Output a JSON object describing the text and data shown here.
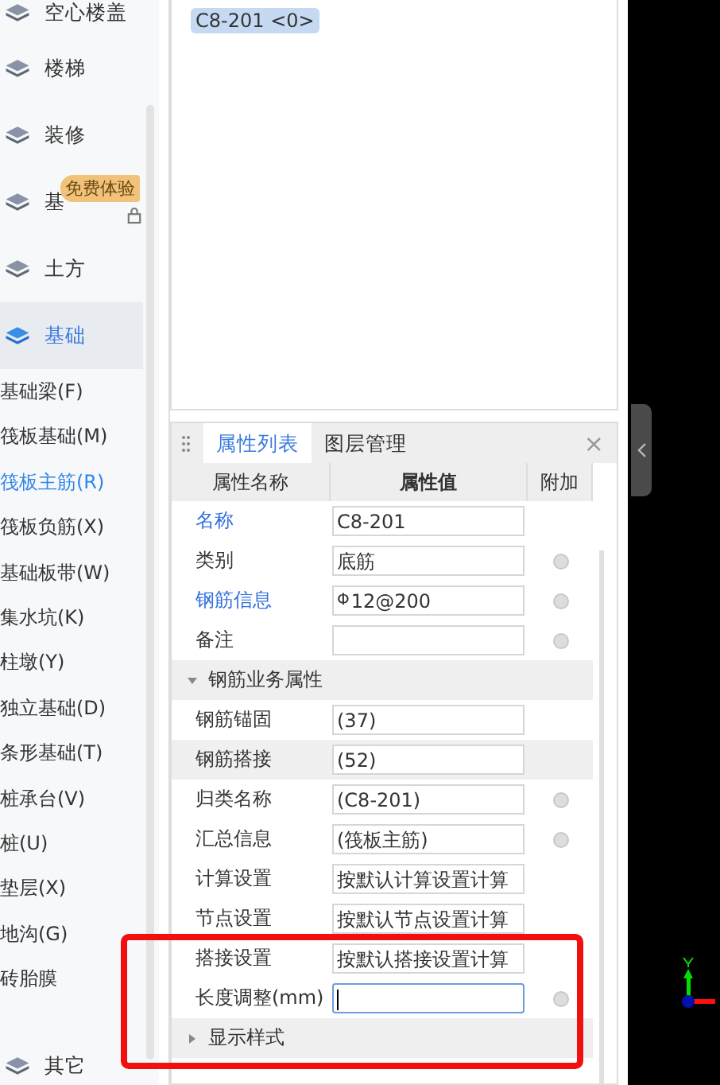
{
  "sidebar": {
    "categories": [
      {
        "label": "空心楼盖",
        "selected": false
      },
      {
        "label": "楼梯",
        "selected": false
      },
      {
        "label": "装修",
        "selected": false
      },
      {
        "label": "基",
        "selected": false,
        "badge": "免费体验",
        "locked": true
      },
      {
        "label": "土方",
        "selected": false
      },
      {
        "label": "基础",
        "selected": true,
        "children": [
          {
            "label": "基础梁(F)",
            "selected": false
          },
          {
            "label": "筏板基础(M)",
            "selected": false
          },
          {
            "label": "筏板主筋(R)",
            "selected": true
          },
          {
            "label": "筏板负筋(X)",
            "selected": false
          },
          {
            "label": "基础板带(W)",
            "selected": false
          },
          {
            "label": "集水坑(K)",
            "selected": false
          },
          {
            "label": "柱墩(Y)",
            "selected": false
          },
          {
            "label": "独立基础(D)",
            "selected": false
          },
          {
            "label": "条形基础(T)",
            "selected": false
          },
          {
            "label": "桩承台(V)",
            "selected": false
          },
          {
            "label": "桩(U)",
            "selected": false
          },
          {
            "label": "垫层(X)",
            "selected": false
          },
          {
            "label": "地沟(G)",
            "selected": false
          },
          {
            "label": "砖胎膜",
            "selected": false
          }
        ]
      },
      {
        "label": "其它",
        "selected": false
      }
    ]
  },
  "component_list": {
    "items": [
      {
        "label": "C8-201 <0>",
        "selected": true
      }
    ]
  },
  "properties_panel": {
    "tabs": [
      {
        "label": "属性列表",
        "selected": true
      },
      {
        "label": "图层管理",
        "selected": false
      }
    ],
    "close": "×",
    "columns": [
      "属性名称",
      "属性值",
      "附加"
    ],
    "rows": [
      {
        "kind": "row",
        "name": "名称",
        "value": "C8-201",
        "linked": true,
        "extra": false,
        "highlighted": false,
        "focused": false
      },
      {
        "kind": "row",
        "name": "类别",
        "value": "底筋",
        "linked": false,
        "extra": true,
        "highlighted": false,
        "focused": false
      },
      {
        "kind": "row",
        "name": "钢筋信息",
        "value": "12@200",
        "rebar_symbol": "Φ",
        "linked": true,
        "extra": true,
        "highlighted": false,
        "focused": false
      },
      {
        "kind": "row",
        "name": "备注",
        "linked": false,
        "extra": true,
        "highlighted": false,
        "focused": false
      },
      {
        "kind": "group",
        "name": "钢筋业务属性",
        "expanded": true
      },
      {
        "kind": "row",
        "name": "钢筋锚固",
        "value": "(37)",
        "linked": false,
        "extra": false,
        "highlighted": false,
        "focused": false
      },
      {
        "kind": "row",
        "name": "钢筋搭接",
        "value": "(52)",
        "linked": false,
        "extra": false,
        "highlighted": true,
        "focused": false
      },
      {
        "kind": "row",
        "name": "归类名称",
        "value": "(C8-201)",
        "linked": false,
        "extra": true,
        "highlighted": false,
        "focused": false
      },
      {
        "kind": "row",
        "name": "汇总信息",
        "value": "(筏板主筋)",
        "linked": false,
        "extra": true,
        "highlighted": false,
        "focused": false
      },
      {
        "kind": "row",
        "name": "计算设置",
        "value": "按默认计算设置计算",
        "linked": false,
        "extra": false,
        "highlighted": false,
        "focused": false
      },
      {
        "kind": "row",
        "name": "节点设置",
        "value": "按默认节点设置计算",
        "linked": false,
        "extra": false,
        "highlighted": false,
        "focused": false
      },
      {
        "kind": "row",
        "name": "搭接设置",
        "value": "按默认搭接设置计算",
        "linked": false,
        "extra": false,
        "highlighted": false,
        "focused": false
      },
      {
        "kind": "row",
        "name": "长度调整(mm)",
        "linked": false,
        "extra": true,
        "highlighted": false,
        "focused": true
      },
      {
        "kind": "group",
        "name": "显示样式",
        "expanded": false
      }
    ]
  },
  "annotation": {
    "highlight": true
  }
}
